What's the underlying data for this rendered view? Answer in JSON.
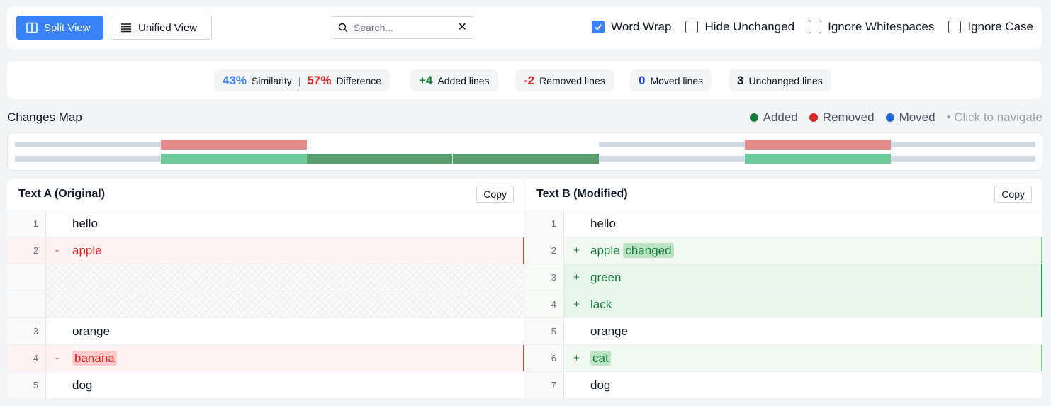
{
  "toolbar": {
    "split_label": "Split View",
    "unified_label": "Unified View",
    "search_placeholder": "Search...",
    "options": {
      "word_wrap": "Word Wrap",
      "hide_unchanged": "Hide Unchanged",
      "ignore_whitespaces": "Ignore Whitespaces",
      "ignore_case": "Ignore Case"
    },
    "word_wrap_checked": true
  },
  "stats": {
    "similarity_value": "43%",
    "similarity_label": "Similarity",
    "separator": "|",
    "difference_value": "57%",
    "difference_label": "Difference",
    "added_value": "+4",
    "added_label": "Added lines",
    "removed_value": "-2",
    "removed_label": "Removed lines",
    "moved_value": "0",
    "moved_label": "Moved lines",
    "unchanged_value": "3",
    "unchanged_label": "Unchanged lines"
  },
  "changes_map": {
    "title": "Changes Map",
    "legend": {
      "added": "Added",
      "removed": "Removed",
      "moved": "Moved",
      "hint": "• Click to navigate"
    },
    "colors": {
      "added": "#15803d",
      "removed": "#dc2626",
      "moved": "#1d6ad8"
    }
  },
  "left_panel": {
    "title": "Text A (Original)",
    "copy_label": "Copy",
    "lines": {
      "r1": {
        "num": "1",
        "marker": "",
        "text": "hello"
      },
      "r2": {
        "num": "2",
        "marker": "-",
        "text": "apple"
      },
      "r3": {
        "num": "3",
        "marker": "",
        "text": "orange"
      },
      "r4": {
        "num": "4",
        "marker": "-",
        "text": "banana"
      },
      "r5": {
        "num": "5",
        "marker": "",
        "text": "dog"
      }
    }
  },
  "right_panel": {
    "title": "Text B (Modified)",
    "copy_label": "Copy",
    "lines": {
      "r1": {
        "num": "1",
        "marker": "",
        "text": "hello"
      },
      "r2": {
        "num": "2",
        "marker": "+",
        "text": "apple",
        "highlight": "changed"
      },
      "r3": {
        "num": "3",
        "marker": "+",
        "text": "green"
      },
      "r4": {
        "num": "4",
        "marker": "+",
        "text": "lack"
      },
      "r5": {
        "num": "5",
        "marker": "",
        "text": "orange"
      },
      "r6": {
        "num": "6",
        "marker": "+",
        "text": "cat"
      },
      "r7": {
        "num": "7",
        "marker": "",
        "text": "dog"
      }
    }
  }
}
